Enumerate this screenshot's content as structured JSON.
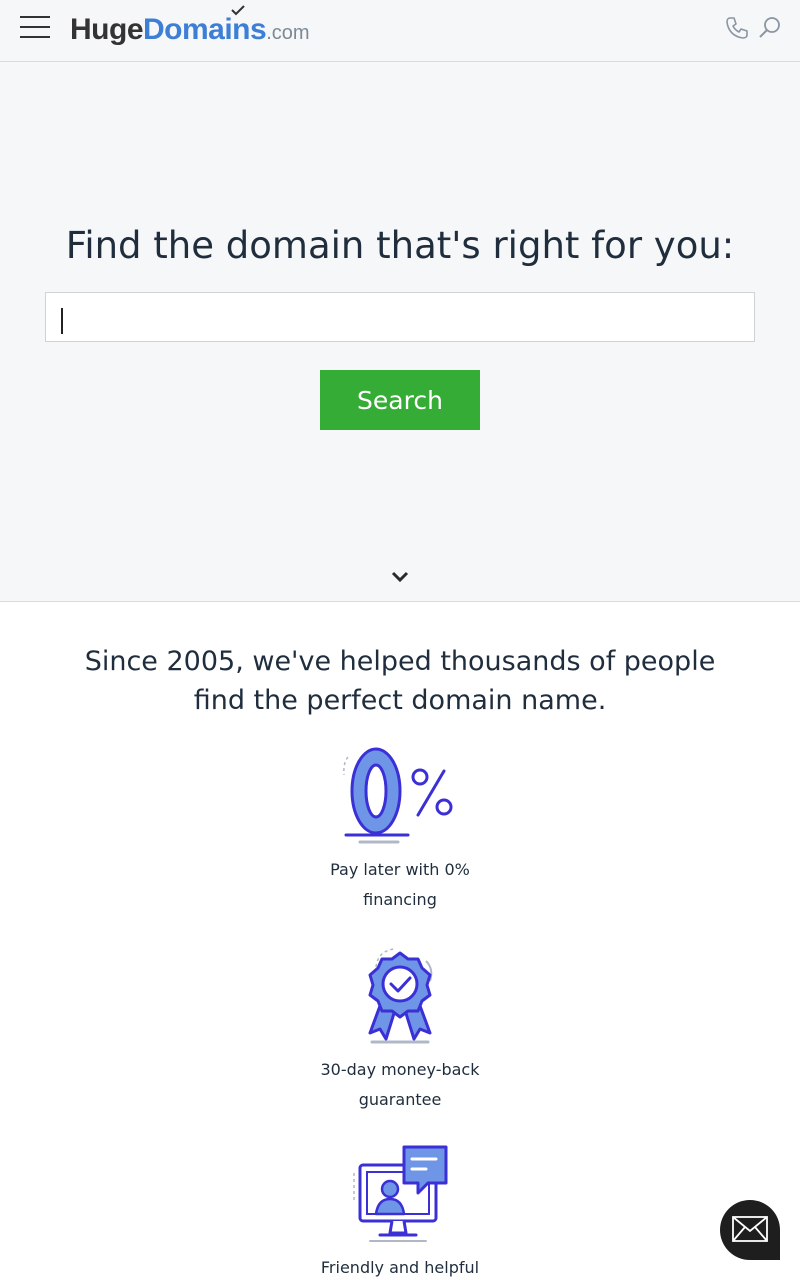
{
  "header": {
    "logo": {
      "part1": "Huge",
      "part2": "Domains",
      "part3": ".com"
    },
    "icons": {
      "menu": "hamburger-menu-icon",
      "phone": "phone-icon",
      "search": "search-icon"
    }
  },
  "hero": {
    "title": "Find the domain that's right for you:",
    "search_value": "",
    "search_button": "Search",
    "scroll_icon": "chevron-down-icon"
  },
  "intro": {
    "line1": "Since 2005, we've helped thousands of people",
    "line2": "find the perfect domain name."
  },
  "features": [
    {
      "icon": "zero-percent-icon",
      "line1": "Pay later with 0%",
      "line2": "financing"
    },
    {
      "icon": "award-ribbon-icon",
      "line1": "30-day money-back",
      "line2": "guarantee"
    },
    {
      "icon": "support-chat-monitor-icon",
      "line1": "Friendly and helpful",
      "line2": ""
    }
  ],
  "contact": {
    "icon": "envelope-icon"
  },
  "colors": {
    "accent_green": "#35ac35",
    "brand_blue": "#3e7fd6",
    "icon_indigo": "#3b2fd6",
    "icon_light_blue": "#6f95e6"
  }
}
